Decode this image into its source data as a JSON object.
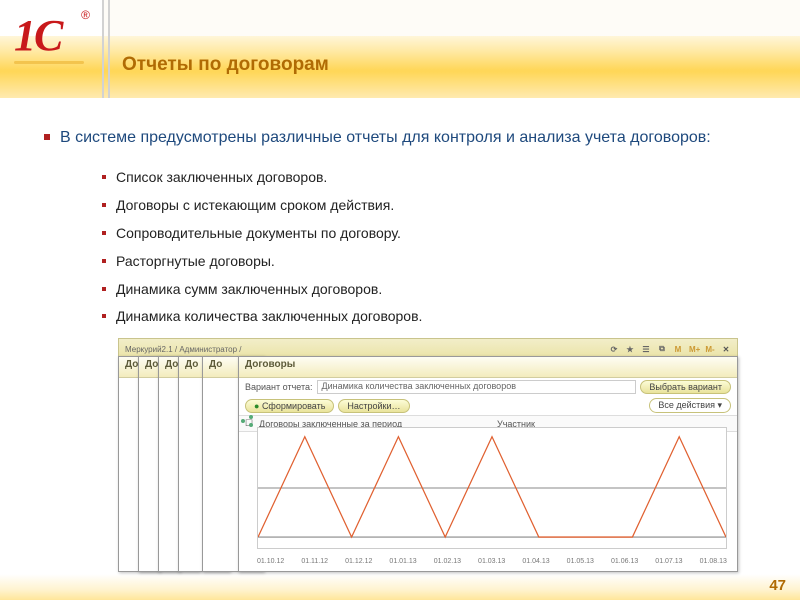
{
  "logo": {
    "text": "1С",
    "reg": "®"
  },
  "title": "Отчеты по договорам",
  "intro": "В системе предусмотрены различные отчеты для контроля и анализа учета договоров:",
  "items": [
    "Список заключенных договоров.",
    "Договоры с истекающим сроком действия.",
    "Сопроводительные документы по договору.",
    "Расторгнутые договоры.",
    "Динамика сумм заключенных договоров.",
    "Динамика количества заключенных договоров."
  ],
  "screenshot": {
    "app_title_left": "Меркурий2.1 / Администратор /",
    "stack_title_prefix": "До",
    "front_title": "Договоры",
    "label_variant": "Вариант отчета:",
    "variant_value": "Динамика количества заключенных договоров",
    "btn_form": "Сформировать",
    "btn_settings": "Настройки…",
    "btn_select_variant": "Выбрать вариант",
    "btn_all_actions": "Все действия ▾",
    "col1": "Договоры заключенные за период",
    "col2": "Участник"
  },
  "chart_data": {
    "type": "line",
    "x": [
      "01.10.12",
      "01.11.12",
      "01.12.12",
      "01.01.13",
      "01.02.13",
      "01.03.13",
      "01.04.13",
      "01.05.13",
      "01.06.13",
      "01.07.13",
      "01.08.13"
    ],
    "values": [
      0,
      5,
      0,
      5,
      0,
      5,
      0,
      0,
      0,
      5,
      0
    ],
    "ylim": [
      0,
      5
    ],
    "title": "Динамика количества заключенных договоров",
    "xlabel": "",
    "ylabel": ""
  },
  "chrome_icons": [
    "⟳",
    "★",
    "☰",
    "⧉",
    "M",
    "M+",
    "M-",
    "✕"
  ],
  "page_number": "47"
}
